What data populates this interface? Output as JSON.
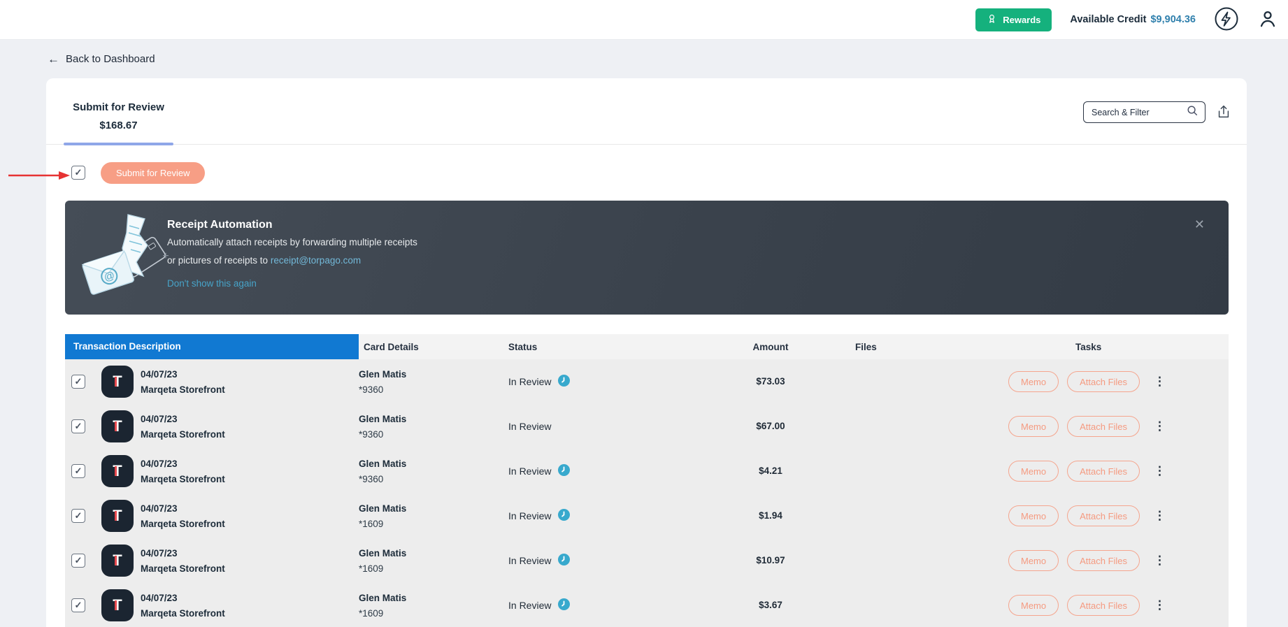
{
  "topbar": {
    "rewards": "Rewards",
    "available_credit_label": "Available Credit",
    "available_credit_value": "$9,904.36"
  },
  "nav": {
    "back": "Back to Dashboard"
  },
  "panel": {
    "tab_title": "Submit for Review",
    "tab_amount": "$168.67",
    "search_placeholder": "Search & Filter",
    "submit_button": "Submit for Review"
  },
  "banner": {
    "title": "Receipt Automation",
    "line1": "Automatically attach receipts by forwarding multiple receipts",
    "line2_prefix": "or pictures of receipts to ",
    "email_link": "receipt@torpago.com",
    "dismiss_link": "Don't show this again"
  },
  "table": {
    "columns": [
      "Transaction Description",
      "Card Details",
      "Status",
      "Amount",
      "Files",
      "Tasks"
    ],
    "actions": {
      "memo": "Memo",
      "attach": "Attach Files"
    },
    "rows": [
      {
        "date": "04/07/23",
        "merchant": "Marqeta Storefront",
        "avatar_letter": "T",
        "cardholder": "Glen Matis",
        "card": "*9360",
        "status": "In Review",
        "clock": true,
        "amount": "$73.03"
      },
      {
        "date": "04/07/23",
        "merchant": "Marqeta Storefront",
        "avatar_letter": "T",
        "cardholder": "Glen Matis",
        "card": "*9360",
        "status": "In Review",
        "clock": false,
        "amount": "$67.00"
      },
      {
        "date": "04/07/23",
        "merchant": "Marqeta Storefront",
        "avatar_letter": "T",
        "cardholder": "Glen Matis",
        "card": "*9360",
        "status": "In Review",
        "clock": true,
        "amount": "$4.21"
      },
      {
        "date": "04/07/23",
        "merchant": "Marqeta Storefront",
        "avatar_letter": "T",
        "cardholder": "Glen Matis",
        "card": "*1609",
        "status": "In Review",
        "clock": true,
        "amount": "$1.94"
      },
      {
        "date": "04/07/23",
        "merchant": "Marqeta Storefront",
        "avatar_letter": "T",
        "cardholder": "Glen Matis",
        "card": "*1609",
        "status": "In Review",
        "clock": true,
        "amount": "$10.97"
      },
      {
        "date": "04/07/23",
        "merchant": "Marqeta Storefront",
        "avatar_letter": "T",
        "cardholder": "Glen Matis",
        "card": "*1609",
        "status": "In Review",
        "clock": true,
        "amount": "$3.67"
      }
    ]
  },
  "icons": {
    "back_arrow": "←",
    "close": "✕",
    "kebab": "⋮",
    "check": "✓"
  },
  "colors": {
    "accent_salmon": "#f79e85",
    "header_blue": "#1179d2",
    "rewards_green": "#15b17d",
    "credit_blue": "#3080ad",
    "tab_underline": "#8fa6e8",
    "banner_link_blue": "#72b8d8",
    "dismiss_link_blue": "#47a3c8",
    "clock_teal": "#38a9cd",
    "annotation_red": "#e63333"
  }
}
